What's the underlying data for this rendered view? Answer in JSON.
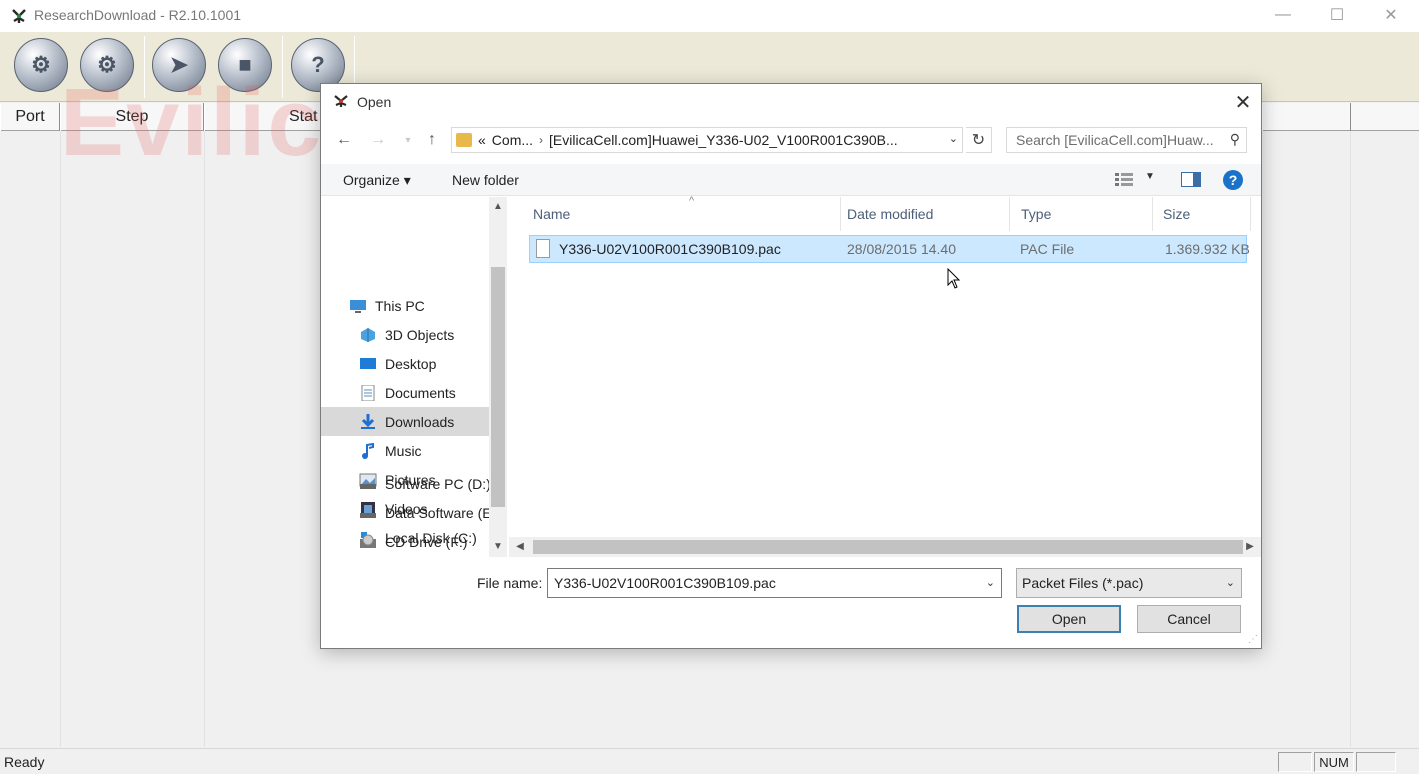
{
  "app": {
    "title": "ResearchDownload - R2.10.1001",
    "status": "Ready",
    "status_num": "NUM"
  },
  "grid": {
    "columns": [
      "Port",
      "Step",
      "Stat"
    ]
  },
  "watermark": "EvilicaCell.com",
  "dialog": {
    "title": "Open",
    "address": {
      "prefix": "«",
      "segments": [
        "Com...",
        "[EvilicaCell.com]Huawei_Y336-U02_V100R001C390B..."
      ]
    },
    "search_placeholder": "Search [EvilicaCell.com]Huaw...",
    "organize": "Organize ▾",
    "new_folder": "New folder",
    "nav_items": [
      {
        "label": "This PC",
        "icon": "this-pc-icon"
      },
      {
        "label": "3D Objects",
        "icon": "3d-objects-icon"
      },
      {
        "label": "Desktop",
        "icon": "desktop-icon"
      },
      {
        "label": "Documents",
        "icon": "documents-icon"
      },
      {
        "label": "Downloads",
        "icon": "downloads-icon"
      },
      {
        "label": "Music",
        "icon": "music-icon"
      },
      {
        "label": "Pictures",
        "icon": "pictures-icon"
      },
      {
        "label": "Videos",
        "icon": "videos-icon"
      },
      {
        "label": "Local Disk (C:)",
        "icon": "local-disk-icon"
      },
      {
        "label": "Software PC (D:)",
        "icon": "drive-icon"
      },
      {
        "label": "Data Software (E",
        "icon": "drive-icon"
      },
      {
        "label": "CD Drive (F:)",
        "icon": "cd-drive-icon"
      }
    ],
    "columns": {
      "name": "Name",
      "date": "Date modified",
      "type": "Type",
      "size": "Size"
    },
    "files": [
      {
        "name": "Y336-U02V100R001C390B109.pac",
        "date": "28/08/2015 14.40",
        "type": "PAC File",
        "size": "1.369.932 KB"
      }
    ],
    "filename_label": "File name:",
    "filename_value": "Y336-U02V100R001C390B109.pac",
    "filter": "Packet Files (*.pac)",
    "open_label": "Open",
    "cancel_label": "Cancel"
  }
}
